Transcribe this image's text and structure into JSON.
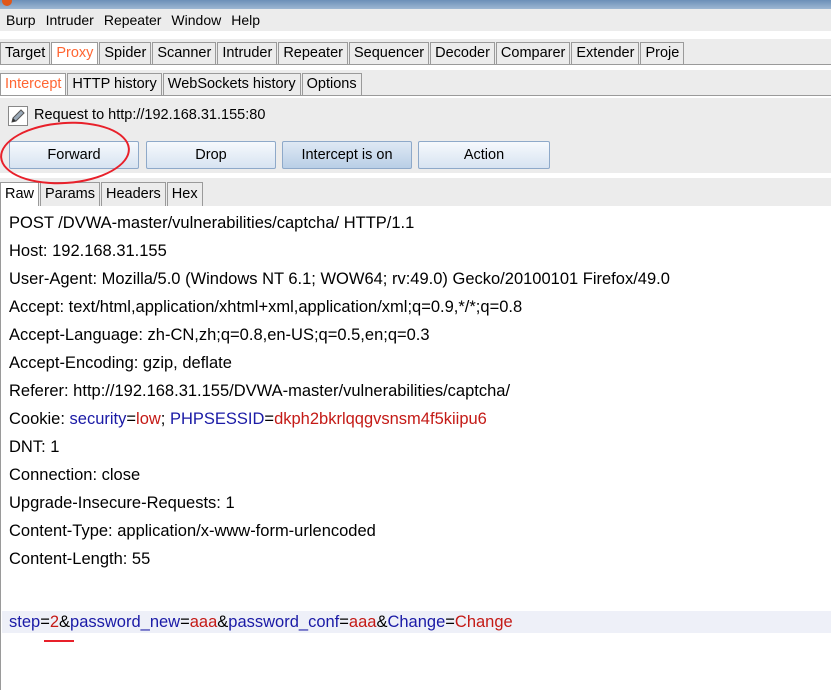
{
  "menubar": [
    "Burp",
    "Intruder",
    "Repeater",
    "Window",
    "Help"
  ],
  "top_tabs": [
    {
      "label": "Target",
      "active": false
    },
    {
      "label": "Proxy",
      "active": true
    },
    {
      "label": "Spider",
      "active": false
    },
    {
      "label": "Scanner",
      "active": false
    },
    {
      "label": "Intruder",
      "active": false
    },
    {
      "label": "Repeater",
      "active": false
    },
    {
      "label": "Sequencer",
      "active": false
    },
    {
      "label": "Decoder",
      "active": false
    },
    {
      "label": "Comparer",
      "active": false
    },
    {
      "label": "Extender",
      "active": false
    },
    {
      "label": "Proje",
      "active": false
    }
  ],
  "sub_tabs": [
    {
      "label": "Intercept",
      "active": true
    },
    {
      "label": "HTTP history",
      "active": false
    },
    {
      "label": "WebSockets history",
      "active": false
    },
    {
      "label": "Options",
      "active": false
    }
  ],
  "request_label": "Request to http://192.168.31.155:80",
  "buttons": {
    "forward": "Forward",
    "drop": "Drop",
    "intercept": "Intercept is on",
    "action": "Action"
  },
  "view_tabs": [
    {
      "label": "Raw",
      "active": true
    },
    {
      "label": "Params",
      "active": false
    },
    {
      "label": "Headers",
      "active": false
    },
    {
      "label": "Hex",
      "active": false
    }
  ],
  "request": {
    "lines": [
      "POST /DVWA-master/vulnerabilities/captcha/ HTTP/1.1",
      "Host: 192.168.31.155",
      "User-Agent: Mozilla/5.0 (Windows NT 6.1; WOW64; rv:49.0) Gecko/20100101 Firefox/49.0",
      "Accept: text/html,application/xhtml+xml,application/xml;q=0.9,*/*;q=0.8",
      "Accept-Language: zh-CN,zh;q=0.8,en-US;q=0.5,en;q=0.3",
      "Accept-Encoding: gzip, deflate",
      "Referer: http://192.168.31.155/DVWA-master/vulnerabilities/captcha/"
    ],
    "cookie": {
      "prefix": "Cookie: ",
      "k1": "security",
      "eq1": "=",
      "v1": "low",
      "sep": "; ",
      "k2": "PHPSESSID",
      "eq2": "=",
      "v2": "dkph2bkrlqqgvsnsm4f5kiipu6"
    },
    "lines2": [
      "DNT: 1",
      "Connection: close",
      "Upgrade-Insecure-Requests: 1",
      "Content-Type: application/x-www-form-urlencoded",
      "Content-Length: 55"
    ],
    "body": {
      "k1": "step",
      "eq": "=",
      "v1": "2",
      "amp": "&",
      "k2": "password_new",
      "v2": "aaa",
      "k3": "password_conf",
      "v3": "aaa",
      "k4": "Change",
      "v4": "Change"
    }
  },
  "colors": {
    "accent_tab": "#ff6633",
    "param_key": "#1a1aa6",
    "param_value": "#c41a16",
    "annotation": "#e8202a"
  }
}
